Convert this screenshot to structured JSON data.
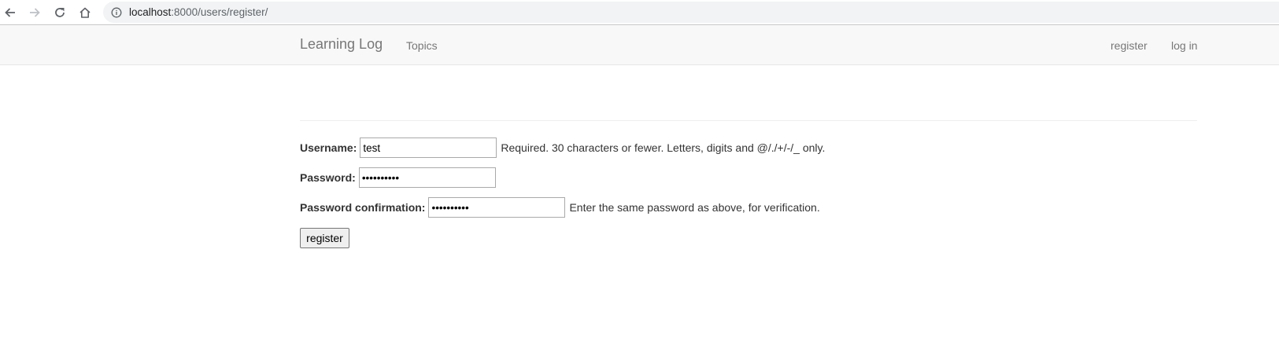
{
  "browser": {
    "url_host": "localhost",
    "url_rest": ":8000/users/register/",
    "back_icon": "arrow-left-icon",
    "forward_icon": "arrow-right-icon",
    "reload_icon": "reload-icon",
    "home_icon": "home-icon",
    "info_icon": "info-icon"
  },
  "navbar": {
    "brand": "Learning Log",
    "topics": "Topics",
    "register": "register",
    "login": "log in"
  },
  "form": {
    "username_label": "Username:",
    "username_value": "test",
    "username_help": "Required. 30 characters or fewer. Letters, digits and @/./+/-/_ only.",
    "password_label": "Password:",
    "password_value": "••••••••••",
    "password_confirm_label": "Password confirmation:",
    "password_confirm_value": "••••••••••",
    "password_confirm_help": "Enter the same password as above, for verification.",
    "submit_label": "register"
  },
  "colors": {
    "navbar_bg": "#f8f8f8",
    "navbar_text": "#777777",
    "omnibox_bg": "#f1f3f4"
  }
}
